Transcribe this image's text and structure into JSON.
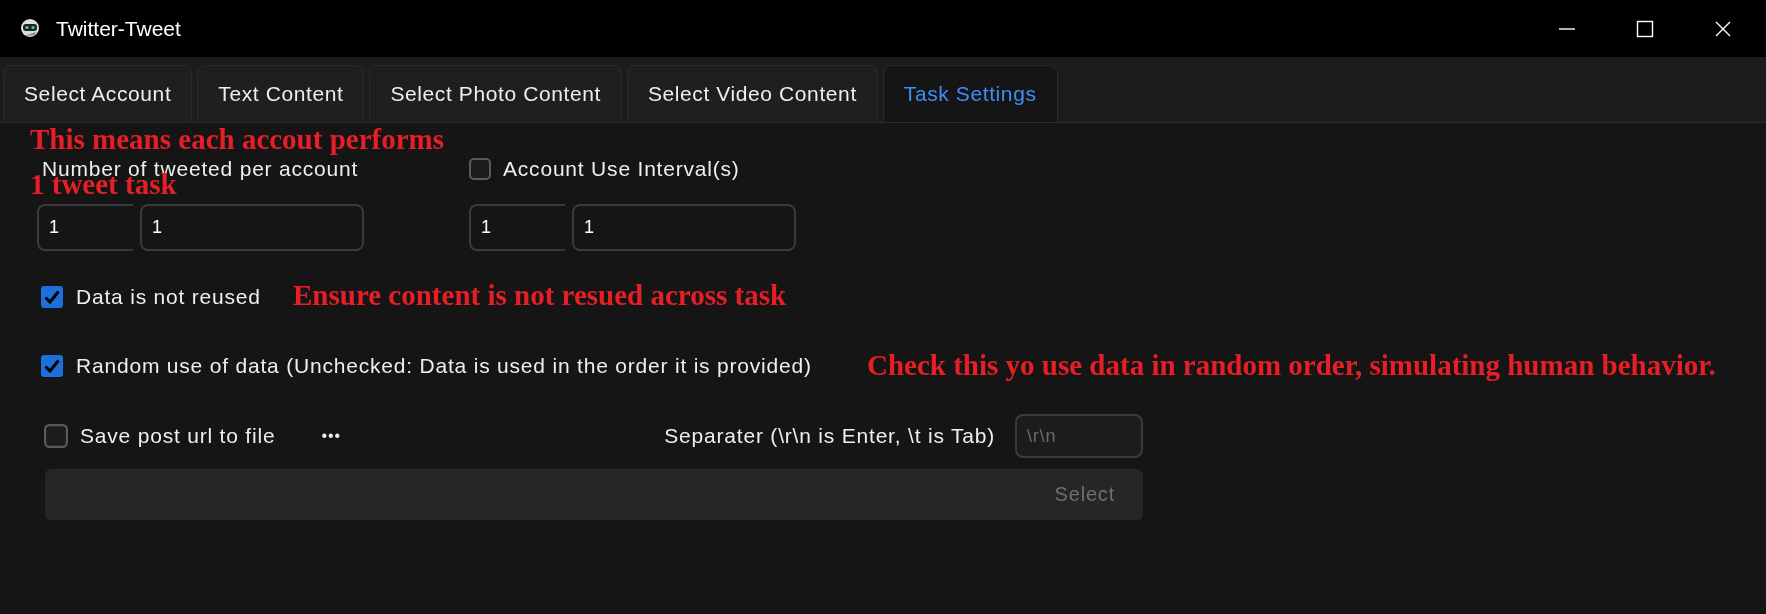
{
  "window": {
    "title": "Twitter-Tweet"
  },
  "tabs": [
    {
      "label": "Select Account",
      "selected": false
    },
    {
      "label": "Text Content",
      "selected": false
    },
    {
      "label": "Select Photo Content",
      "selected": false
    },
    {
      "label": "Select Video Content",
      "selected": false
    },
    {
      "label": "Task Settings",
      "selected": true
    }
  ],
  "tweets_per_account": {
    "label": "Number of tweeted per account",
    "from": "1",
    "to": "1"
  },
  "account_interval": {
    "label": "Account Use Interval(s)",
    "checked": false,
    "from": "1",
    "to": "1"
  },
  "options": [
    {
      "label": "Data is not reused",
      "checked": true
    },
    {
      "label": "Random use of data (Unchecked: Data is used in the order it is provided)",
      "checked": true
    }
  ],
  "save_url": {
    "label": "Save post url to file",
    "checked": false,
    "more": "•••",
    "separator_label": "Separater (\\r\\n is Enter, \\t is Tab)",
    "separator_placeholder": "\\r\\n",
    "select_button": {
      "label": "Select",
      "disabled": true
    }
  },
  "annotations": [
    {
      "text": "This means each accout performs"
    },
    {
      "text": "1 tweet task"
    },
    {
      "text": "Ensure content is not resued across task"
    },
    {
      "text": "Check this yo use data in random order, simulating human behavior."
    }
  ]
}
